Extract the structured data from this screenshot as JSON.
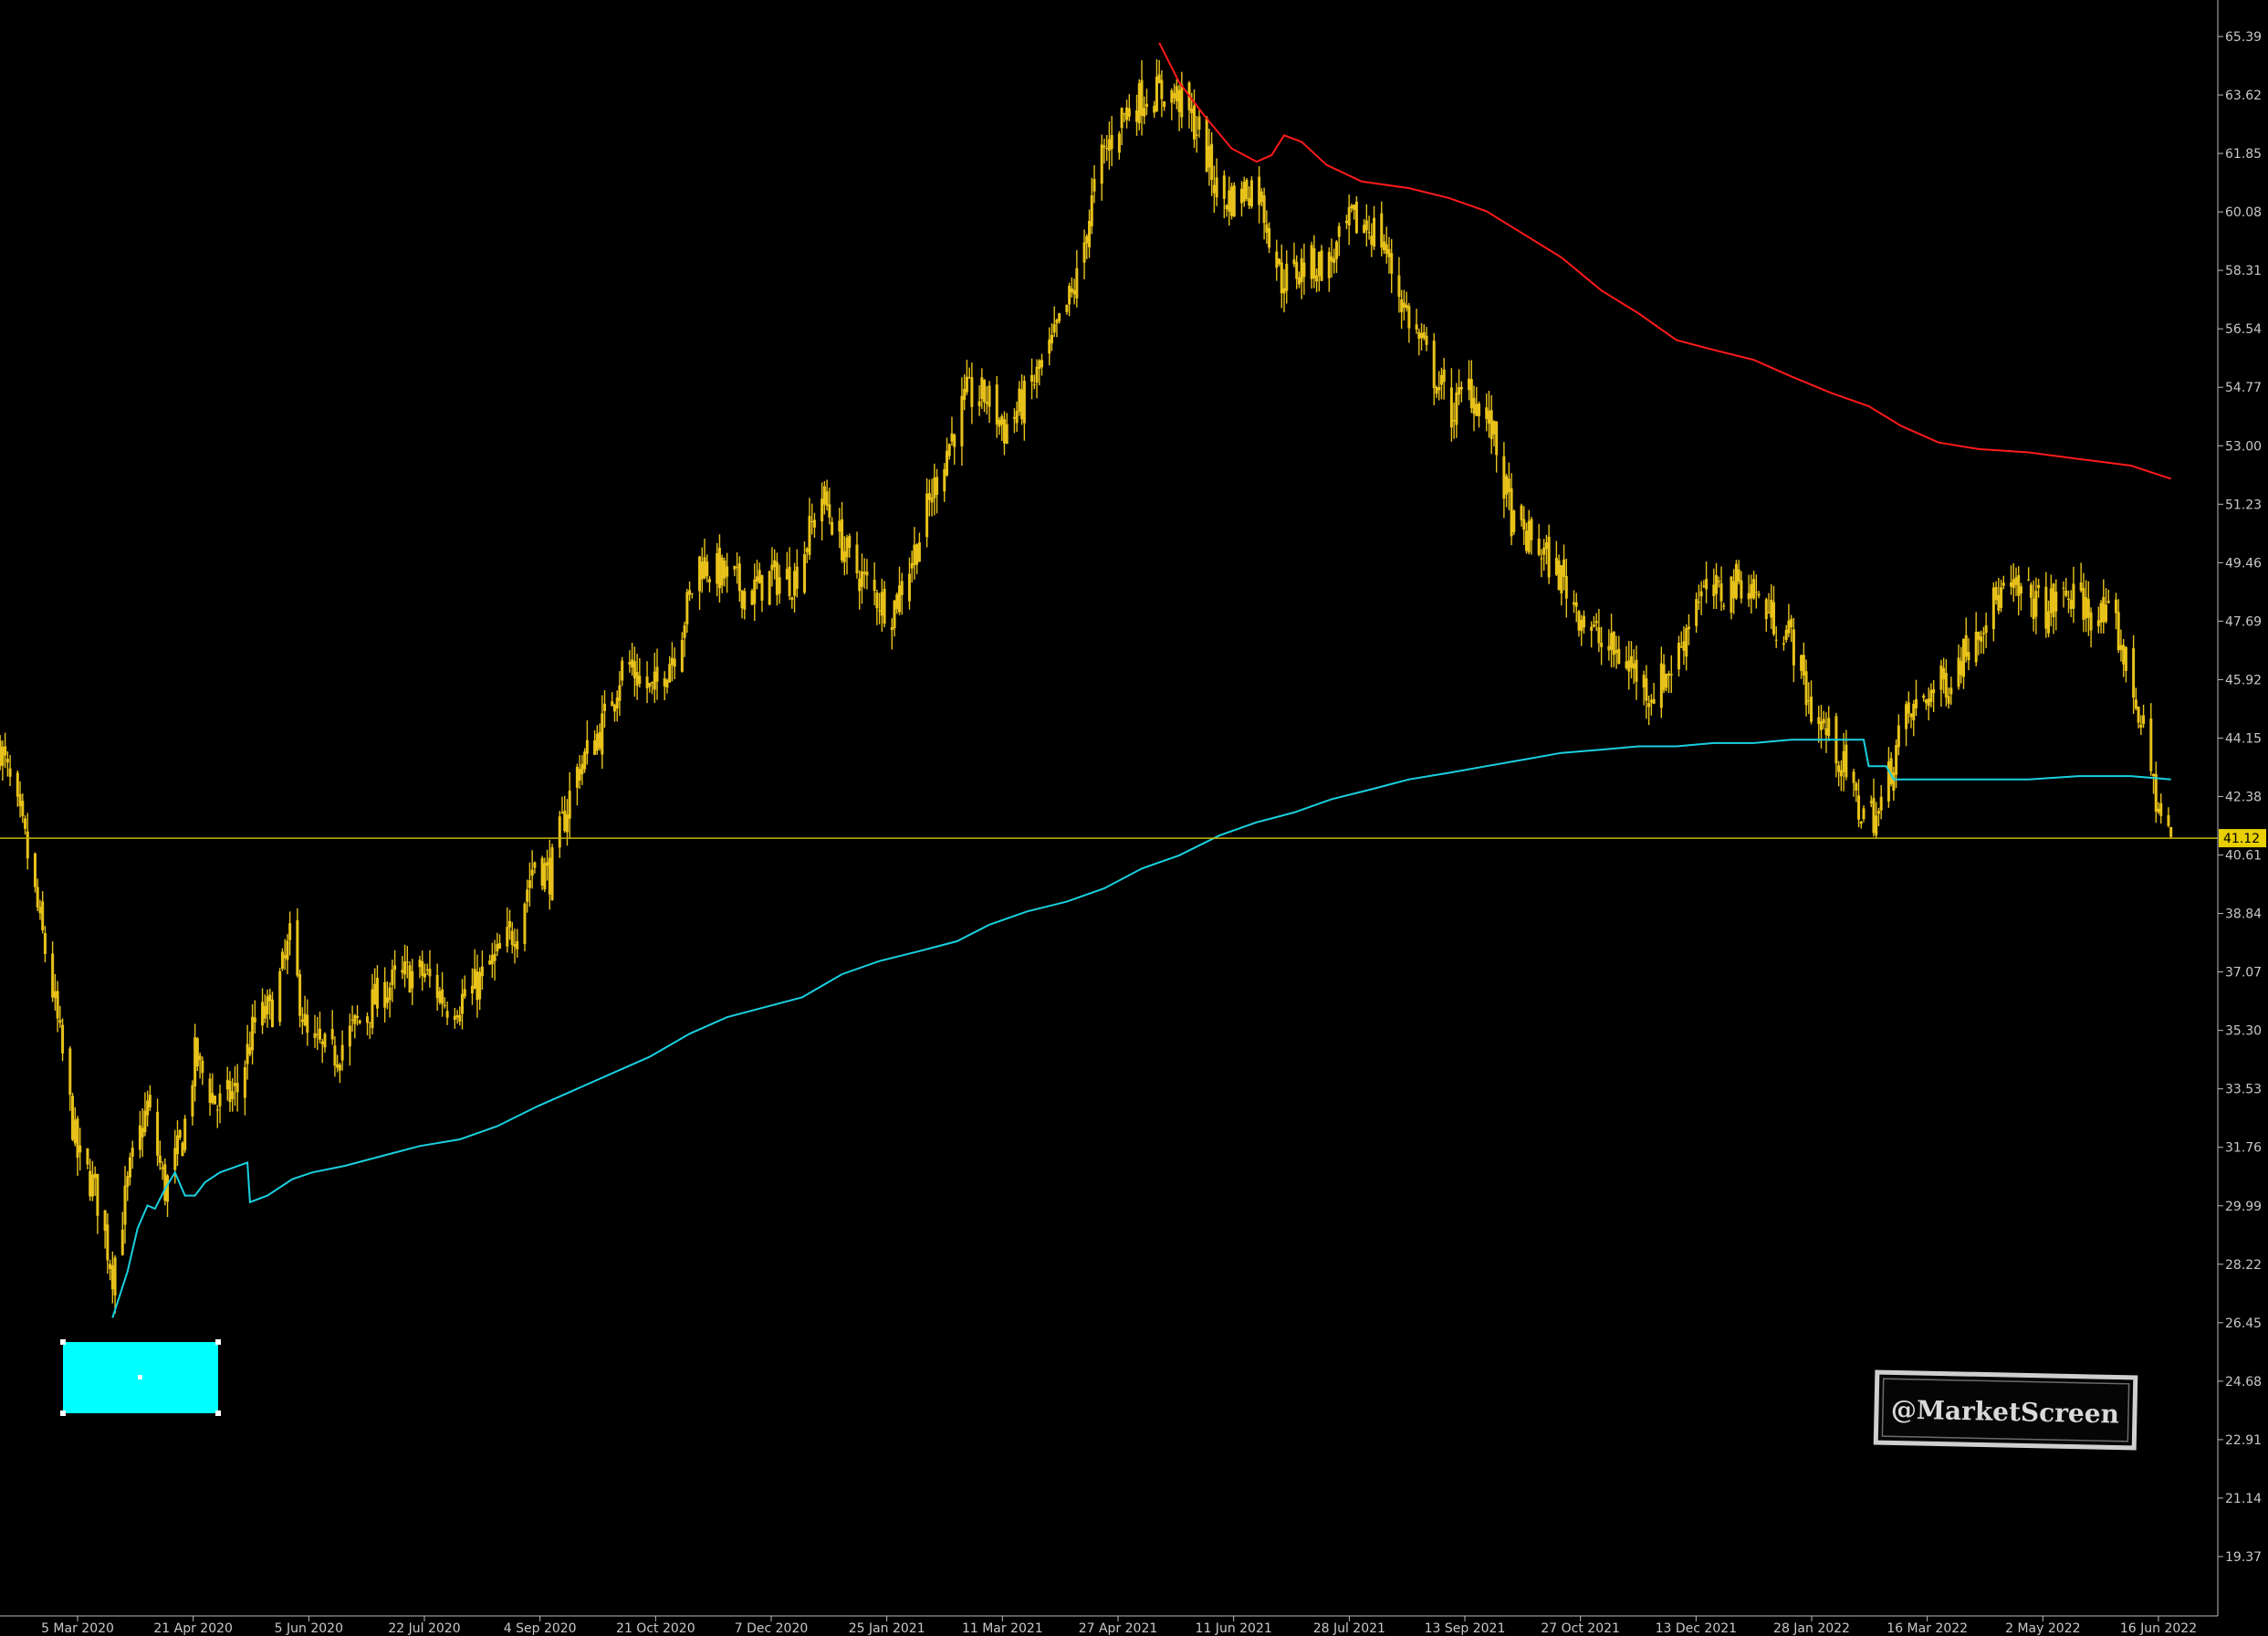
{
  "chart_data": {
    "type": "line",
    "title": "",
    "xlabel": "",
    "ylabel": "",
    "ylim": [
      17.6,
      67.2
    ],
    "grid": false,
    "y_ticks": [
      "65.39",
      "63.62",
      "61.85",
      "60.08",
      "58.31",
      "56.54",
      "54.77",
      "53.00",
      "51.23",
      "49.46",
      "47.69",
      "45.92",
      "44.15",
      "42.38",
      "40.61",
      "38.84",
      "37.07",
      "35.30",
      "33.53",
      "31.76",
      "29.99",
      "28.22",
      "26.45",
      "24.68",
      "22.91",
      "21.14",
      "19.37"
    ],
    "x_ticks": [
      "5 Mar 2020",
      "21 Apr 2020",
      "5 Jun 2020",
      "22 Jul 2020",
      "4 Sep 2020",
      "21 Oct 2020",
      "7 Dec 2020",
      "25 Jan 2021",
      "11 Mar 2021",
      "27 Apr 2021",
      "11 Jun 2021",
      "28 Jul 2021",
      "13 Sep 2021",
      "27 Oct 2021",
      "13 Dec 2021",
      "28 Jan 2022",
      "16 Mar 2022",
      "2 May 2022",
      "16 Jun 2022"
    ],
    "last_price": "41.12",
    "series": [
      {
        "color": "#e8c21a",
        "x": [
          "2020-02-03",
          "2020-02-13",
          "2020-02-24",
          "2020-03-05",
          "2020-03-12",
          "2020-03-19",
          "2020-03-26",
          "2020-04-02",
          "2020-04-09",
          "2020-04-16",
          "2020-04-21",
          "2020-04-30",
          "2020-05-08",
          "2020-05-15",
          "2020-05-22",
          "2020-05-29",
          "2020-06-05",
          "2020-06-15",
          "2020-06-25",
          "2020-07-05",
          "2020-07-15",
          "2020-07-22",
          "2020-08-01",
          "2020-08-10",
          "2020-08-20",
          "2020-08-28",
          "2020-09-04",
          "2020-09-10",
          "2020-09-20",
          "2020-10-01",
          "2020-10-10",
          "2020-10-21",
          "2020-10-31",
          "2020-11-09",
          "2020-11-20",
          "2020-11-29",
          "2020-12-07",
          "2020-12-17",
          "2020-12-28",
          "2021-01-08",
          "2021-01-18",
          "2021-01-25",
          "2021-02-04",
          "2021-02-14",
          "2021-02-24",
          "2021-03-04",
          "2021-03-11",
          "2021-03-20",
          "2021-03-30",
          "2021-04-09",
          "2021-04-18",
          "2021-04-27",
          "2021-05-06",
          "2021-05-14",
          "2021-05-20",
          "2021-05-28",
          "2021-06-05",
          "2021-06-11",
          "2021-06-20",
          "2021-06-30",
          "2021-07-10",
          "2021-07-19",
          "2021-07-28",
          "2021-08-08",
          "2021-08-18",
          "2021-08-28",
          "2021-09-06",
          "2021-09-13",
          "2021-09-22",
          "2021-10-01",
          "2021-10-10",
          "2021-10-20",
          "2021-10-27",
          "2021-11-05",
          "2021-11-15",
          "2021-11-25",
          "2021-12-05",
          "2021-12-13",
          "2021-12-22",
          "2022-01-01",
          "2022-01-10",
          "2022-01-20",
          "2022-01-28",
          "2022-02-06",
          "2022-02-16",
          "2022-02-24",
          "2022-03-05",
          "2022-03-16",
          "2022-03-25",
          "2022-04-04",
          "2022-04-14",
          "2022-04-24",
          "2022-05-02",
          "2022-05-10",
          "2022-05-20",
          "2022-05-30",
          "2022-06-08",
          "2022-06-16",
          "2022-06-21"
        ],
        "values": [
          43.9,
          41.0,
          36.5,
          31.5,
          30.5,
          28.0,
          31.0,
          33.0,
          30.5,
          32.0,
          34.5,
          33.0,
          33.5,
          35.5,
          36.0,
          38.0,
          35.0,
          34.5,
          35.5,
          36.5,
          37.0,
          37.0,
          36.0,
          36.5,
          37.5,
          38.5,
          40.5,
          40.0,
          43.0,
          44.5,
          46.5,
          45.5,
          47.0,
          49.5,
          49.0,
          48.5,
          49.0,
          49.0,
          51.5,
          49.5,
          48.5,
          48.0,
          50.0,
          52.5,
          54.5,
          54.5,
          53.5,
          54.5,
          56.0,
          58.0,
          61.5,
          63.0,
          63.6,
          63.7,
          63.5,
          62.5,
          60.5,
          60.5,
          61.0,
          58.0,
          58.5,
          58.5,
          59.8,
          59.5,
          57.2,
          55.5,
          54.0,
          54.8,
          53.5,
          50.5,
          50.0,
          49.0,
          48.0,
          47.0,
          46.5,
          45.5,
          46.5,
          48.5,
          48.5,
          49.0,
          48.0,
          47.2,
          45.0,
          44.0,
          42.0,
          41.8,
          44.5,
          45.5,
          46.0,
          47.5,
          48.5,
          48.5,
          48.0,
          48.5,
          48.0,
          47.5,
          45.0,
          42.0,
          41.1
        ]
      },
      {
        "color": "#ff1a1a",
        "x": [
          "2021-05-12",
          "2021-05-20",
          "2021-05-30",
          "2021-06-10",
          "2021-06-20",
          "2021-06-26",
          "2021-07-01",
          "2021-07-08",
          "2021-07-18",
          "2021-08-01",
          "2021-08-20",
          "2021-09-05",
          "2021-09-20",
          "2021-10-05",
          "2021-10-20",
          "2021-11-05",
          "2021-11-20",
          "2021-12-05",
          "2021-12-20",
          "2022-01-05",
          "2022-01-20",
          "2022-02-05",
          "2022-02-20",
          "2022-03-05",
          "2022-03-20",
          "2022-04-05",
          "2022-04-25",
          "2022-05-15",
          "2022-06-05",
          "2022-06-21"
        ],
        "values": [
          65.2,
          64.0,
          63.0,
          62.0,
          61.6,
          61.8,
          62.4,
          62.2,
          61.5,
          61.0,
          60.8,
          60.5,
          60.1,
          59.4,
          58.7,
          57.7,
          57.0,
          56.2,
          55.9,
          55.6,
          55.1,
          54.6,
          54.2,
          53.6,
          53.1,
          52.9,
          52.8,
          52.6,
          52.4,
          52.0
        ]
      },
      {
        "color": "#1ad0e0",
        "x": [
          "2020-03-19",
          "2020-03-25",
          "2020-03-29",
          "2020-04-02",
          "2020-04-05",
          "2020-04-09",
          "2020-04-13",
          "2020-04-17",
          "2020-04-21",
          "2020-04-25",
          "2020-05-01",
          "2020-05-12",
          "2020-05-13",
          "2020-05-20",
          "2020-05-30",
          "2020-06-07",
          "2020-06-20",
          "2020-07-05",
          "2020-07-20",
          "2020-08-05",
          "2020-08-20",
          "2020-09-05",
          "2020-09-20",
          "2020-10-05",
          "2020-10-20",
          "2020-11-05",
          "2020-11-20",
          "2020-12-05",
          "2020-12-20",
          "2021-01-05",
          "2021-01-20",
          "2021-02-05",
          "2021-02-20",
          "2021-03-05",
          "2021-03-20",
          "2021-04-05",
          "2021-04-20",
          "2021-05-05",
          "2021-05-20",
          "2021-06-05",
          "2021-06-20",
          "2021-07-05",
          "2021-07-20",
          "2021-08-05",
          "2021-08-20",
          "2021-09-05",
          "2021-09-20",
          "2021-10-05",
          "2021-10-20",
          "2021-11-05",
          "2021-11-20",
          "2021-12-05",
          "2021-12-20",
          "2022-01-05",
          "2022-01-20",
          "2022-02-05",
          "2022-02-18",
          "2022-02-20",
          "2022-02-27",
          "2022-03-02",
          "2022-03-20",
          "2022-04-05",
          "2022-04-25",
          "2022-05-15",
          "2022-06-05",
          "2022-06-21"
        ],
        "values": [
          26.6,
          28.0,
          29.3,
          30.0,
          29.9,
          30.5,
          31.0,
          30.3,
          30.3,
          30.7,
          31.0,
          31.3,
          30.1,
          30.3,
          30.8,
          31.0,
          31.2,
          31.5,
          31.8,
          32.0,
          32.4,
          33.0,
          33.5,
          34.0,
          34.5,
          35.2,
          35.7,
          36.0,
          36.3,
          37.0,
          37.4,
          37.7,
          38.0,
          38.5,
          38.9,
          39.2,
          39.6,
          40.2,
          40.6,
          41.2,
          41.6,
          41.9,
          42.3,
          42.6,
          42.9,
          43.1,
          43.3,
          43.5,
          43.7,
          43.8,
          43.9,
          43.9,
          44.0,
          44.0,
          44.1,
          44.1,
          44.1,
          43.3,
          43.3,
          42.9,
          42.9,
          42.9,
          42.9,
          43.0,
          43.0,
          42.9
        ]
      }
    ]
  },
  "watermark": {
    "label": "@MarketScreen"
  }
}
